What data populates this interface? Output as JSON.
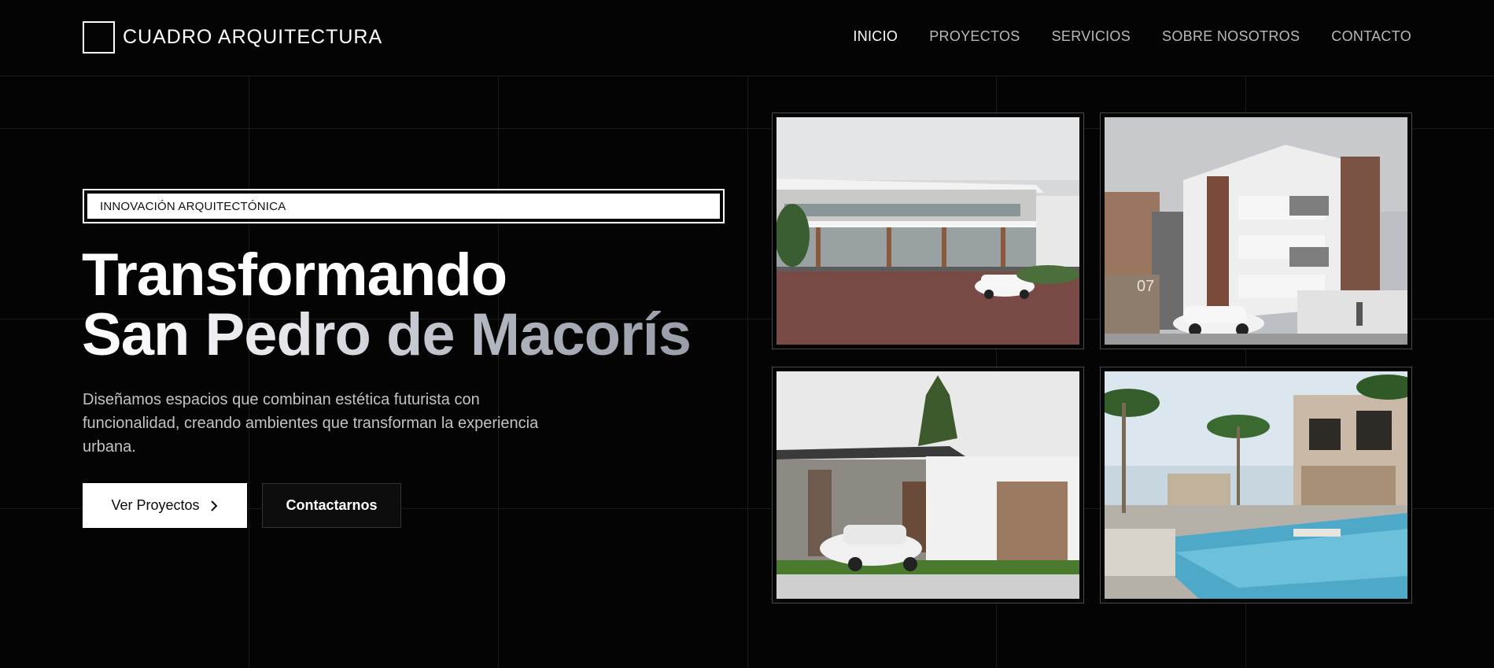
{
  "brand": {
    "name": "CUADRO ARQUITECTURA",
    "logo_icon": "square-outline"
  },
  "nav": {
    "items": [
      {
        "label": "INICIO",
        "active": true
      },
      {
        "label": "PROYECTOS",
        "active": false
      },
      {
        "label": "SERVICIOS",
        "active": false
      },
      {
        "label": "SOBRE NOSOTROS",
        "active": false
      },
      {
        "label": "CONTACTO",
        "active": false
      }
    ]
  },
  "hero": {
    "badge": "INNOVACIÓN ARQUITECTÓNICA",
    "title_line1": "Transformando",
    "title_line2": "San Pedro de Macorís",
    "description": "Diseñamos espacios que combinan estética futurista con funcionalidad, creando ambientes que transforman la experiencia urbana.",
    "primary_button": "Ver Proyectos",
    "primary_button_icon": "chevron-right",
    "secondary_button": "Contactarnos"
  },
  "gallery": {
    "images": [
      {
        "name": "commercial-building-render",
        "sign": ""
      },
      {
        "name": "apartment-building-render",
        "sign": "07"
      },
      {
        "name": "modern-house-render",
        "sign": ""
      },
      {
        "name": "resort-pool-render",
        "sign": ""
      }
    ]
  },
  "colors": {
    "background": "#040404",
    "text": "#ffffff",
    "muted": "#c3c3c3",
    "nav_inactive": "#b9b9b9"
  }
}
